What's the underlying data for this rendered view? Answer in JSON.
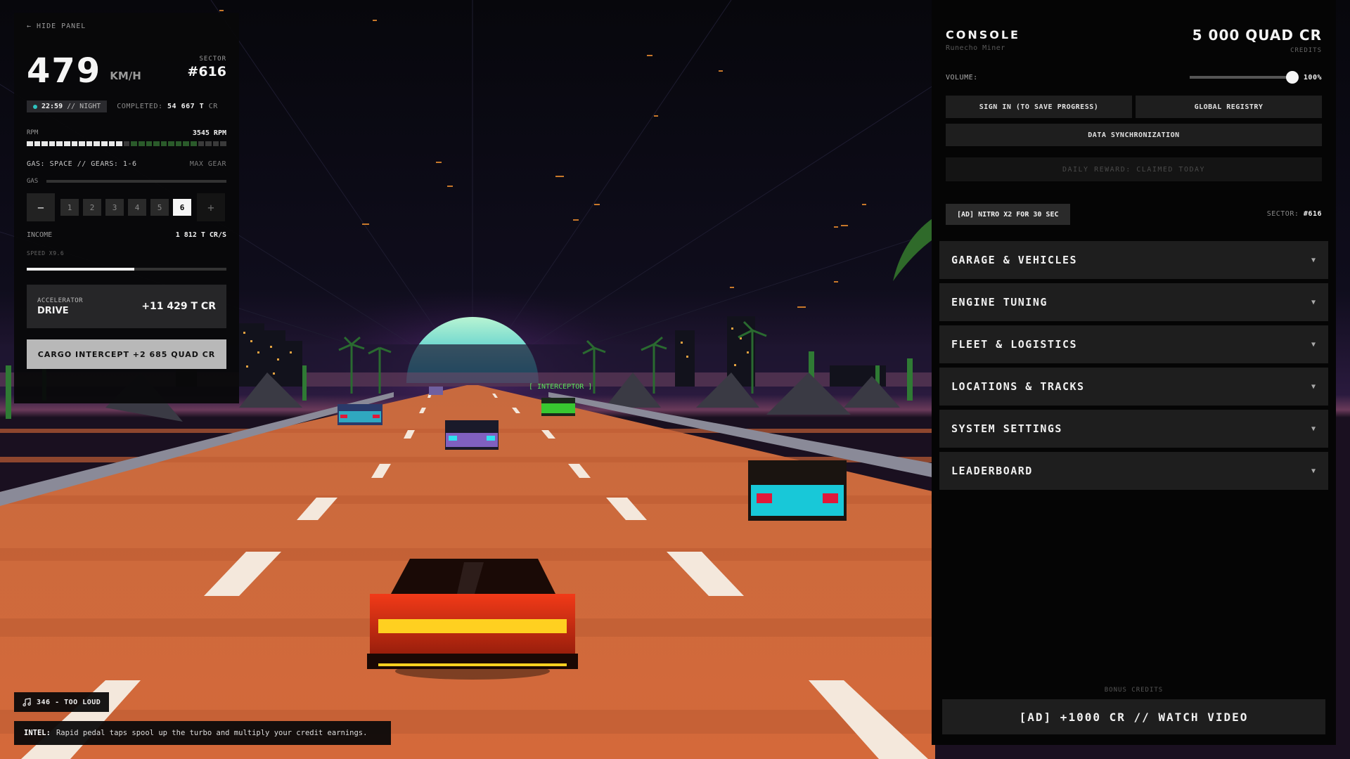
{
  "left_panel": {
    "hide_label": "← HIDE PANEL",
    "speed": "479",
    "speed_unit": "KM/H",
    "sector_label": "SECTOR",
    "sector_value": "#616",
    "clock": "22:59",
    "clock_suffix": "// NIGHT",
    "completed_label": "COMPLETED:",
    "completed_value": "54 667 T",
    "completed_unit": "CR",
    "rpm_label": "RPM",
    "rpm_value": "3545 RPM",
    "rpm_level": 0.48,
    "gears_info": "GAS: SPACE // GEARS: 1-6",
    "max_gear": "MAX GEAR",
    "gas_label": "GAS",
    "minus": "−",
    "plus": "+",
    "gears": [
      "1",
      "2",
      "3",
      "4",
      "5",
      "6"
    ],
    "active_gear": "6",
    "income_label": "INCOME",
    "income_value": "1 812 T CR/S",
    "speed_mult": "SPEED X9.6",
    "speed_mult_level": 0.54,
    "accelerator_label": "ACCELERATOR",
    "accelerator_name": "DRIVE",
    "accelerator_value": "+11 429 T CR",
    "cargo_button": "CARGO INTERCEPT +2 685 QUAD CR"
  },
  "music": {
    "label": "346 - TOO LOUD",
    "icon": "music-note-icon"
  },
  "intel": {
    "label": "INTEL:",
    "text": "Rapid pedal taps spool up the turbo and multiply your credit earnings."
  },
  "scene": {
    "intercept_tag": "[ INTERCEPTOR ]"
  },
  "console": {
    "title": "CONSOLE",
    "subtitle": "Runecho Miner",
    "credits": "5 000 QUAD CR",
    "credits_label": "CREDITS",
    "volume_label": "VOLUME:",
    "volume_value": "100%",
    "volume_level": 1.0,
    "sign_in": "SIGN IN (TO SAVE PROGRESS)",
    "registry": "GLOBAL REGISTRY",
    "sync": "DATA SYNCHRONIZATION",
    "daily_reward": "DAILY REWARD: CLAIMED TODAY",
    "ad_nitro": "[AD] NITRO X2 FOR 30 SEC",
    "sector_label": "SECTOR:",
    "sector_value": "#616",
    "sections": [
      {
        "label": "GARAGE & VEHICLES"
      },
      {
        "label": "ENGINE TUNING"
      },
      {
        "label": "FLEET & LOGISTICS"
      },
      {
        "label": "LOCATIONS & TRACKS"
      },
      {
        "label": "SYSTEM SETTINGS"
      },
      {
        "label": "LEADERBOARD"
      }
    ],
    "bonus_label": "BONUS CREDITS",
    "watch_video": "[AD] +1000 CR // WATCH VIDEO"
  },
  "colors": {
    "road": "#d46a3c",
    "sun_top": "#aef0d0",
    "sun_bottom": "#1fb8c8",
    "accent_teal": "#2ec4c0",
    "player_car": "#e8391c"
  }
}
